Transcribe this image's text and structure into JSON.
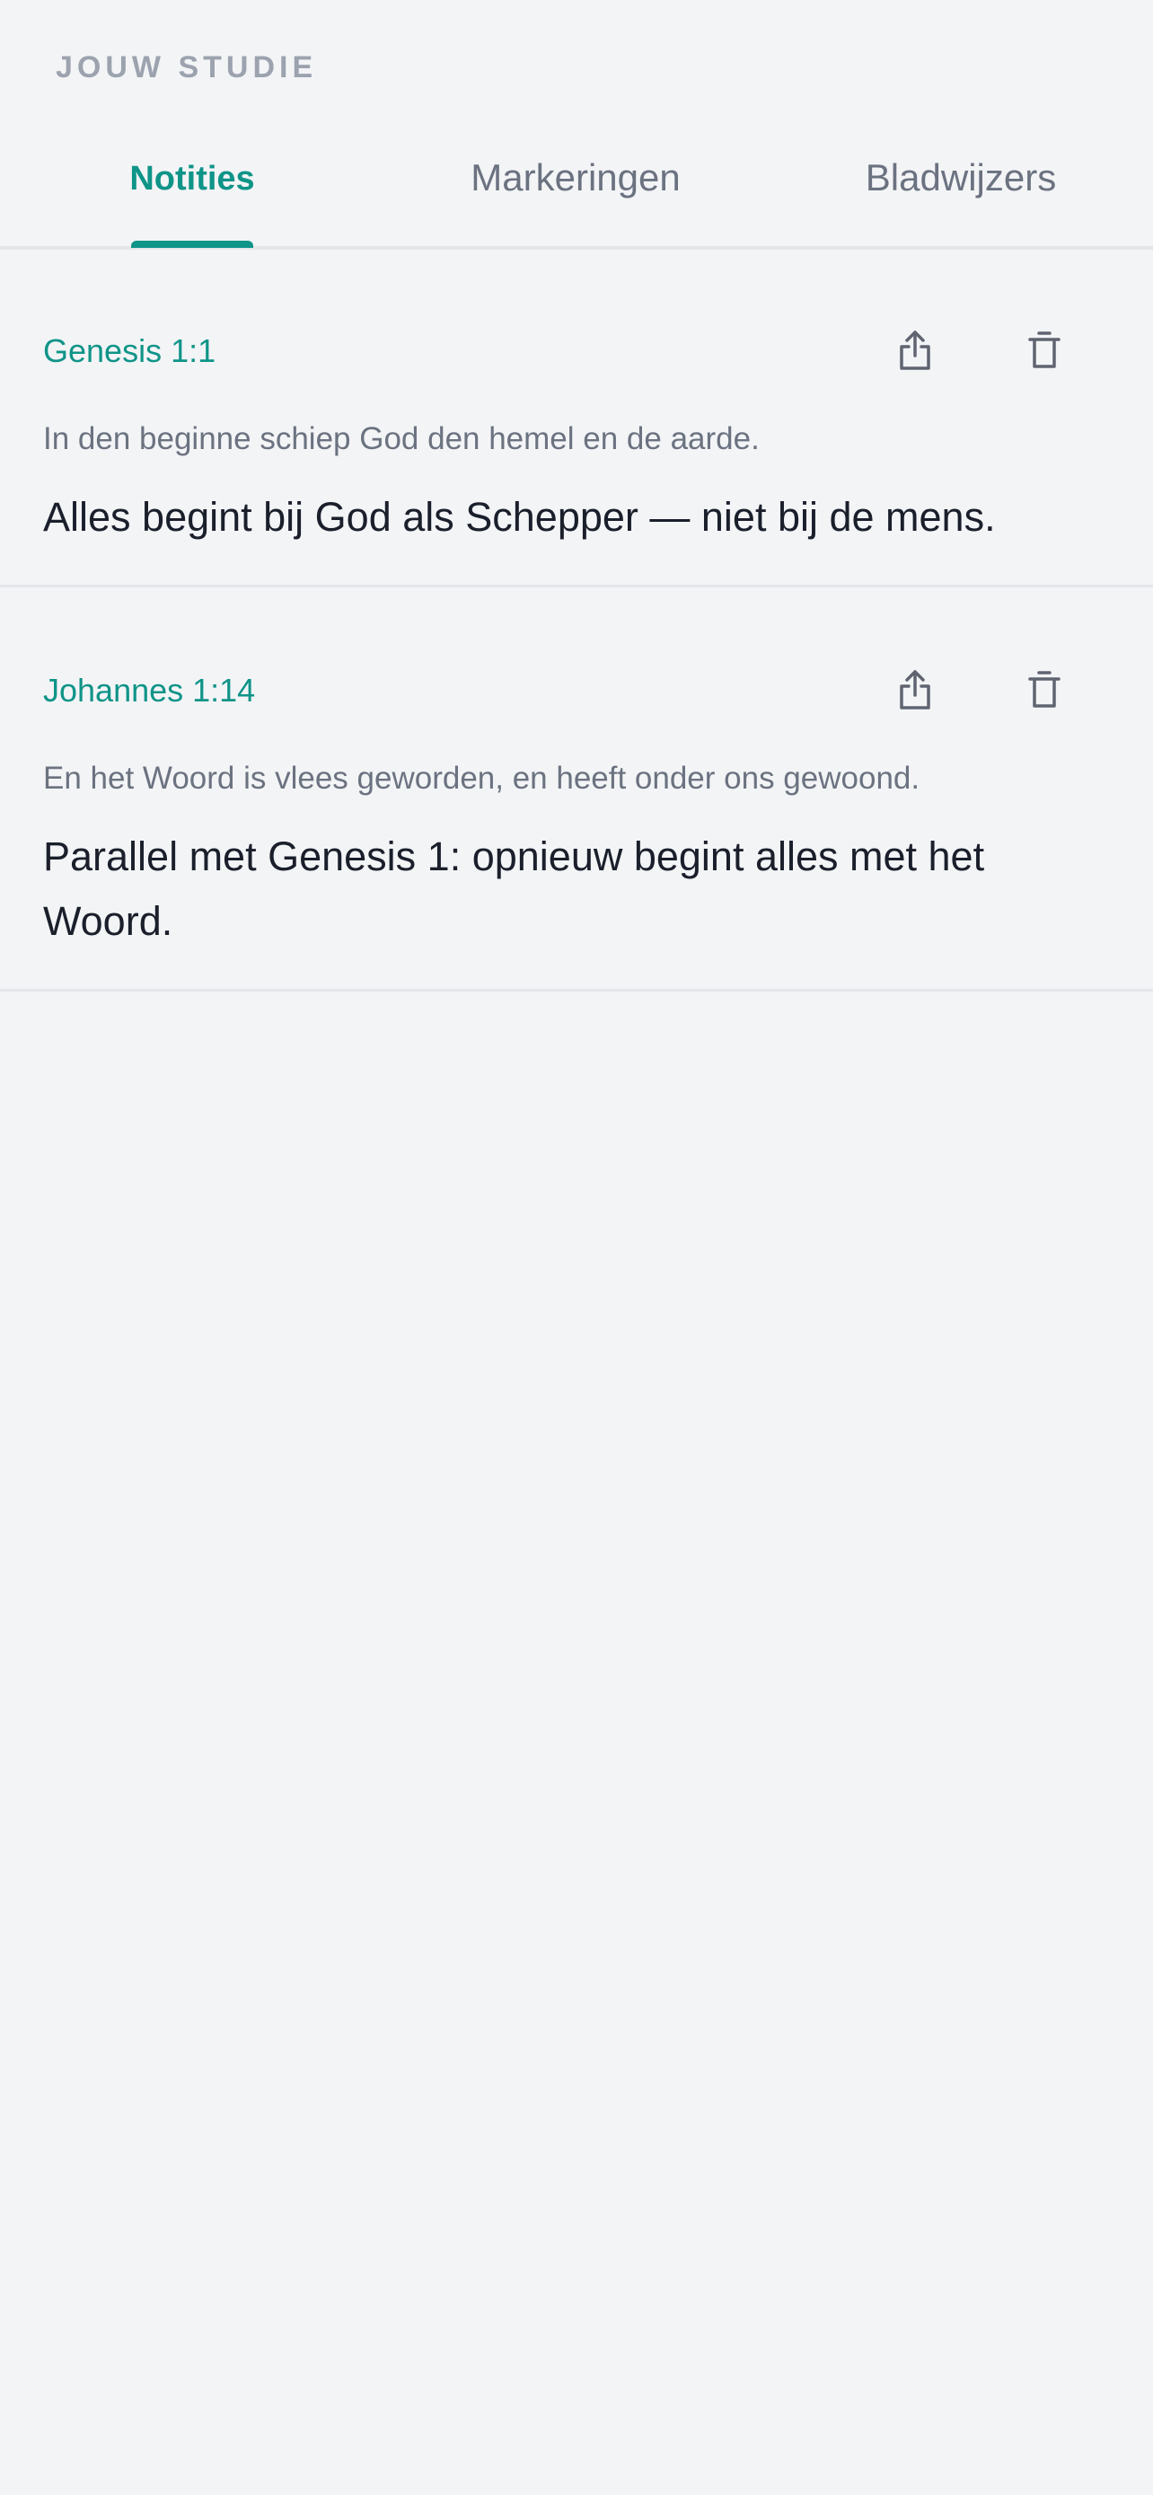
{
  "header": {
    "section_label": "JOUW STUDIE"
  },
  "tabs": [
    {
      "label": "Notities",
      "active": true
    },
    {
      "label": "Markeringen",
      "active": false
    },
    {
      "label": "Bladwijzers",
      "active": false
    }
  ],
  "colors": {
    "accent": "#0f9488",
    "background": "#f3f4f6",
    "muted_text": "#6b7280",
    "body_text": "#1a1f2b",
    "divider": "#e4e6ea"
  },
  "icons": {
    "share": "share-icon",
    "delete": "trash-icon"
  },
  "notes": [
    {
      "reference": "Genesis 1:1",
      "verse": "In den beginne schiep God den hemel en de aarde.",
      "note": "Alles begint bij God als Schepper — niet bij de mens."
    },
    {
      "reference": "Johannes 1:14",
      "verse": "En het Woord is vlees geworden, en heeft onder ons gewoond.",
      "note": "Parallel met Genesis 1: opnieuw begint alles met het Woord."
    }
  ]
}
